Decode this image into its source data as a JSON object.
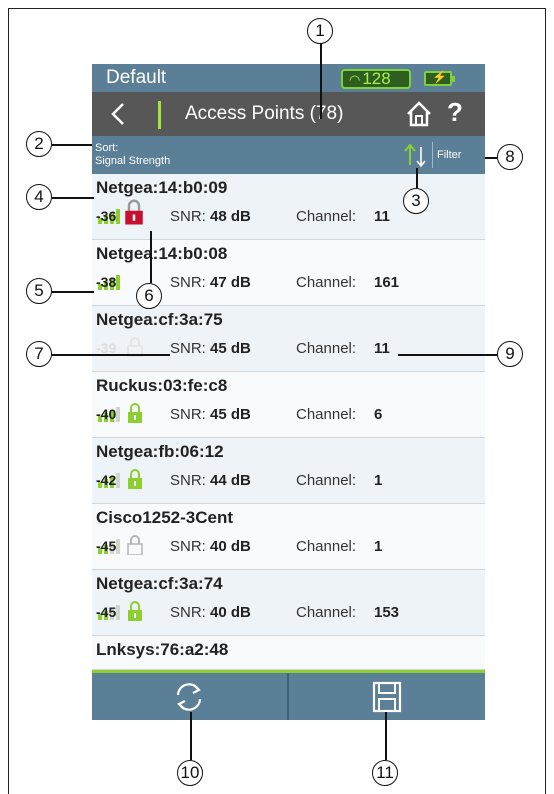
{
  "status": {
    "profile": "Default",
    "wifi_count": "128"
  },
  "header": {
    "title": "Access Points (78)"
  },
  "sortbar": {
    "sort_line1": "Sort:",
    "sort_line2": "Signal Strength",
    "filter": "Filter"
  },
  "rows": [
    {
      "name": "Netgea:14:b0:09",
      "rssi": "-36",
      "snr_label": "SNR:",
      "snr": "48 dB",
      "channel_label": "Channel:",
      "channel": "11",
      "lock": "locked-red"
    },
    {
      "name": "Netgea:14:b0:08",
      "rssi": "-38",
      "snr_label": "SNR:",
      "snr": "47 dB",
      "channel_label": "Channel:",
      "channel": "161",
      "lock": "green"
    },
    {
      "name": "Netgea:cf:3a:75",
      "rssi": "-39",
      "snr_label": "SNR:",
      "snr": "45 dB",
      "channel_label": "Channel:",
      "channel": "11",
      "lock": "gray"
    },
    {
      "name": "Ruckus:03:fe:c8",
      "rssi": "-40",
      "snr_label": "SNR:",
      "snr": "45 dB",
      "channel_label": "Channel:",
      "channel": "6",
      "lock": "green"
    },
    {
      "name": "Netgea:fb:06:12",
      "rssi": "-42",
      "snr_label": "SNR:",
      "snr": "44 dB",
      "channel_label": "Channel:",
      "channel": "1",
      "lock": "green"
    },
    {
      "name": "Cisco1252-3Cent",
      "rssi": "-45",
      "snr_label": "SNR:",
      "snr": "40 dB",
      "channel_label": "Channel:",
      "channel": "1",
      "lock": "gray"
    },
    {
      "name": "Netgea:cf:3a:74",
      "rssi": "-45",
      "snr_label": "SNR:",
      "snr": "40 dB",
      "channel_label": "Channel:",
      "channel": "153",
      "lock": "green"
    },
    {
      "name": "Lnksys:76:a2:48"
    }
  ],
  "callouts": [
    "1",
    "2",
    "3",
    "4",
    "5",
    "6",
    "7",
    "8",
    "9",
    "10",
    "11"
  ],
  "colors": {
    "accent_green": "#8ccf2e",
    "bar_blue": "#5b7f96",
    "header_gray": "#575757",
    "lock_red": "#c8102e"
  }
}
